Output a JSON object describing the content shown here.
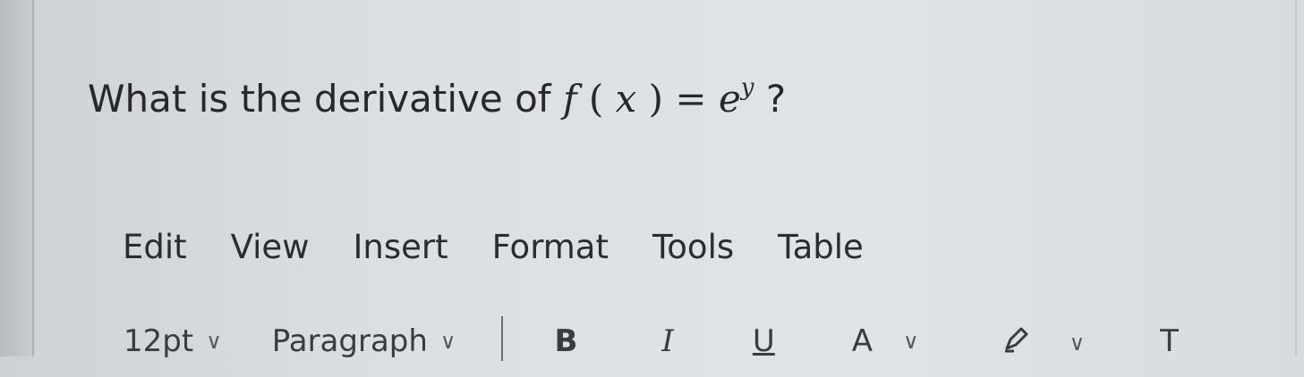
{
  "question": {
    "prefix": "What is the derivative of ",
    "func": "f",
    "arg_open": " (",
    "arg_var": "x",
    "arg_close": ")",
    "equals": " = ",
    "base": "e",
    "exponent": "y",
    "suffix": "?"
  },
  "menubar": {
    "items": [
      "Edit",
      "View",
      "Insert",
      "Format",
      "Tools",
      "Table"
    ]
  },
  "toolbar": {
    "font_size_value": "12pt",
    "block_format_value": "Paragraph",
    "bold_label": "B",
    "italic_label": "I",
    "underline_label": "U",
    "text_color_label": "A",
    "more_label": "T"
  },
  "icons": {
    "dropdown": "chevron-down-icon",
    "highlight": "pencil-icon"
  }
}
